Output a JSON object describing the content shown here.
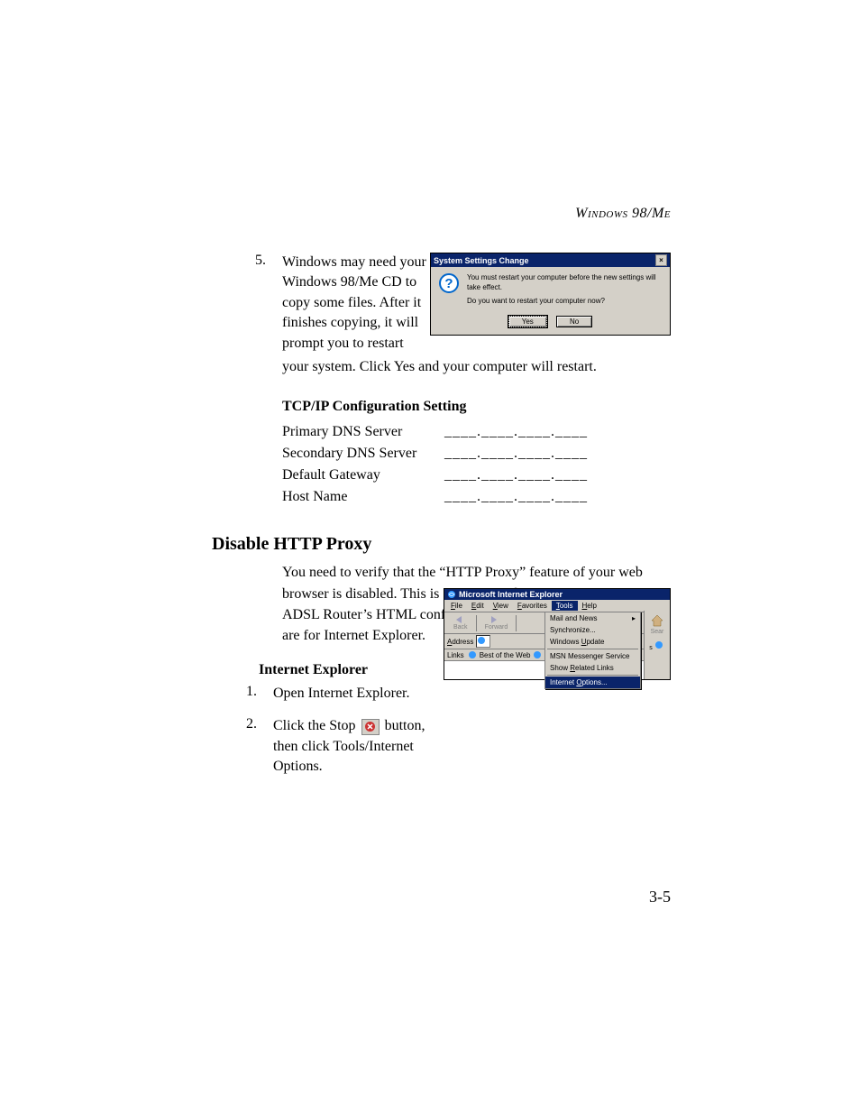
{
  "header": "Windows 98/Me",
  "step5": {
    "num": "5.",
    "text_wrap": "Windows may need your Windows 98/Me CD to copy some files. After it finishes copying, it will prompt you to restart",
    "text_cont": "your system. Click Yes and your computer will restart."
  },
  "dialog1": {
    "title": "System Settings Change",
    "msg1": "You must restart your computer before the new settings will take effect.",
    "msg2": "Do you want to restart your computer now?",
    "yes": "Yes",
    "no": "No"
  },
  "tcpip": {
    "heading": "TCP/IP Configuration Setting",
    "rows": [
      {
        "label": "Primary DNS Server",
        "val": "____.____.____.____"
      },
      {
        "label": "Secondary DNS Server",
        "val": "____.____.____.____"
      },
      {
        "label": "Default Gateway",
        "val": "____.____.____.____"
      },
      {
        "label": "Host Name",
        "val": "____.____.____.____"
      }
    ]
  },
  "section2": {
    "heading": "Disable HTTP Proxy",
    "para": "You need to verify that the “HTTP Proxy” feature of your web browser is disabled. This is so that your browser can view the ADSL Router’s HTML configuration pages. The following steps are for Internet Explorer.",
    "sub": "Internet Explorer",
    "step1_num": "1.",
    "step1": "Open Internet Explorer.",
    "step2_num": "2.",
    "step2a": "Click the Stop",
    "step2b": "button, then click Tools/Internet Options."
  },
  "ie": {
    "title": "Microsoft Internet Explorer",
    "menu": {
      "file": "File",
      "edit": "Edit",
      "view": "View",
      "favorites": "Favorites",
      "tools": "Tools",
      "help": "Help"
    },
    "toolbar": {
      "back": "Back",
      "forward": "Forward"
    },
    "address_label": "Address",
    "links_label": "Links",
    "links_item": "Best of the Web",
    "search": "Sear",
    "dropdown": {
      "mail": "Mail and News",
      "sync": "Synchronize...",
      "update": "Windows Update",
      "msn": "MSN Messenger Service",
      "related": "Show Related Links",
      "options": "Internet Options..."
    }
  },
  "pagenum": "3-5"
}
